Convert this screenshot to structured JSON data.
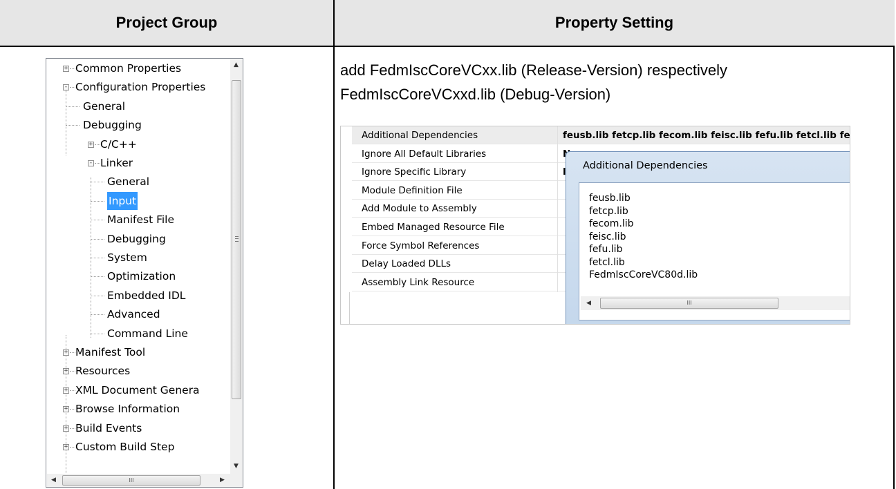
{
  "table": {
    "header_left": "Project Group",
    "header_right": "Property Setting"
  },
  "tree": {
    "items": [
      {
        "label": "Common Properties",
        "expander": "+"
      },
      {
        "label": "Configuration Properties",
        "expander": "-"
      },
      {
        "label": "General"
      },
      {
        "label": "Debugging"
      },
      {
        "label": "C/C++",
        "expander": "+"
      },
      {
        "label": "Linker",
        "expander": "-"
      },
      {
        "label": "General"
      },
      {
        "label": "Input",
        "selected": true
      },
      {
        "label": "Manifest File"
      },
      {
        "label": "Debugging"
      },
      {
        "label": "System"
      },
      {
        "label": "Optimization"
      },
      {
        "label": "Embedded IDL"
      },
      {
        "label": "Advanced"
      },
      {
        "label": "Command Line"
      },
      {
        "label": "Manifest Tool",
        "expander": "+"
      },
      {
        "label": "Resources",
        "expander": "+"
      },
      {
        "label": "XML Document Genera",
        "expander": "+"
      },
      {
        "label": "Browse Information",
        "expander": "+"
      },
      {
        "label": "Build Events",
        "expander": "+"
      },
      {
        "label": "Custom Build Step",
        "expander": "+"
      }
    ]
  },
  "description": {
    "line1": "add FedmIscCoreVCxx.lib (Release-Version) respectively",
    "line2": "FedmIscCoreVCxxd.lib (Debug-Version)"
  },
  "properties": {
    "rows": [
      {
        "name": "Additional Dependencies",
        "value": "feusb.lib fetcp.lib fecom.lib feisc.lib fefu.lib fetcl.lib fe"
      },
      {
        "name": "Ignore All Default Libraries",
        "value": "No"
      },
      {
        "name": "Ignore Specific Library",
        "value": "lib"
      },
      {
        "name": "Module Definition File",
        "value": ""
      },
      {
        "name": "Add Module to Assembly",
        "value": ""
      },
      {
        "name": "Embed Managed Resource File",
        "value": ""
      },
      {
        "name": "Force Symbol References",
        "value": ""
      },
      {
        "name": "Delay Loaded DLLs",
        "value": ""
      },
      {
        "name": "Assembly Link Resource",
        "value": ""
      }
    ]
  },
  "dialog": {
    "title": "Additional Dependencies",
    "libs": [
      "feusb.lib",
      "fetcp.lib",
      "fecom.lib",
      "feisc.lib",
      "fefu.lib",
      "fetcl.lib",
      "FedmIscCoreVC80d.lib"
    ],
    "scroll_grip": "III"
  }
}
